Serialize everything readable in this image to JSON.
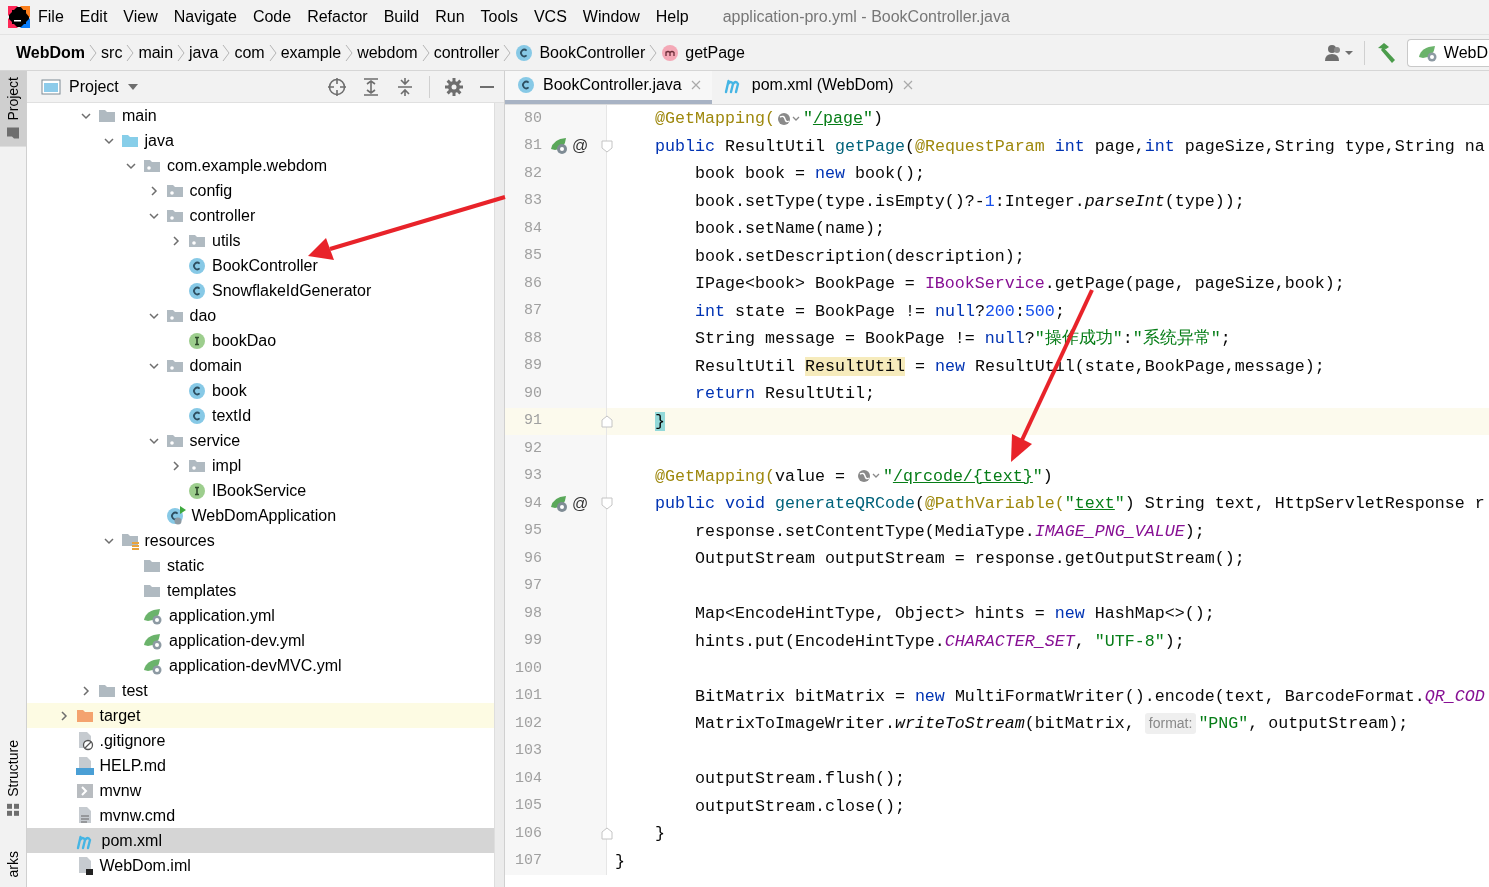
{
  "menu": [
    {
      "label": "File"
    },
    {
      "label": "Edit"
    },
    {
      "label": "View"
    },
    {
      "label": "Navigate"
    },
    {
      "label": "Code"
    },
    {
      "label": "Refactor"
    },
    {
      "label": "Build"
    },
    {
      "label": "Run"
    },
    {
      "label": "Tools"
    },
    {
      "label": "VCS"
    },
    {
      "label": "Window"
    },
    {
      "label": "Help"
    }
  ],
  "title": "application-pro.yml - BookController.java",
  "breadcrumbs": [
    {
      "label": "WebDom",
      "kind": "project"
    },
    {
      "label": "src",
      "kind": "folder"
    },
    {
      "label": "main",
      "kind": "folder"
    },
    {
      "label": "java",
      "kind": "folder"
    },
    {
      "label": "com",
      "kind": "folder"
    },
    {
      "label": "example",
      "kind": "folder"
    },
    {
      "label": "webdom",
      "kind": "folder"
    },
    {
      "label": "controller",
      "kind": "folder"
    },
    {
      "label": "BookController",
      "kind": "class"
    },
    {
      "label": "getPage",
      "kind": "method"
    }
  ],
  "toolbar": {
    "run_config": "WebD"
  },
  "tool_strip": [
    {
      "label": "Project",
      "selected": true
    },
    {
      "label": "Structure",
      "selected": false
    },
    {
      "label": "arks",
      "selected": false
    }
  ],
  "project_panel": {
    "title": "Project",
    "src_children": [
      {
        "label": "main",
        "kind": "folder",
        "expanded": true,
        "selected": false,
        "children": [
          {
            "label": "java",
            "kind": "source",
            "expanded": true,
            "selected": false,
            "children": [
              {
                "label": "com.example.webdom",
                "kind": "package",
                "expanded": true,
                "selected": false,
                "children": [
                  {
                    "label": "config",
                    "kind": "package",
                    "expanded": false,
                    "selected": false
                  },
                  {
                    "label": "controller",
                    "kind": "package",
                    "expanded": true,
                    "selected": false,
                    "children": [
                      {
                        "label": "utils",
                        "kind": "package",
                        "expanded": false,
                        "selected": false
                      },
                      {
                        "label": "BookController",
                        "kind": "class",
                        "selected": false
                      },
                      {
                        "label": "SnowflakeIdGenerator",
                        "kind": "class",
                        "selected": false
                      }
                    ]
                  },
                  {
                    "label": "dao",
                    "kind": "package",
                    "expanded": true,
                    "selected": false,
                    "children": [
                      {
                        "label": "bookDao",
                        "kind": "interface",
                        "selected": false
                      }
                    ]
                  },
                  {
                    "label": "domain",
                    "kind": "package",
                    "expanded": true,
                    "selected": false,
                    "children": [
                      {
                        "label": "book",
                        "kind": "class",
                        "selected": false
                      },
                      {
                        "label": "textId",
                        "kind": "class",
                        "selected": false
                      }
                    ]
                  },
                  {
                    "label": "service",
                    "kind": "package",
                    "expanded": true,
                    "selected": false,
                    "children": [
                      {
                        "label": "impl",
                        "kind": "package",
                        "expanded": false,
                        "selected": false
                      },
                      {
                        "label": "IBookService",
                        "kind": "interface",
                        "selected": false
                      }
                    ]
                  },
                  {
                    "label": "WebDomApplication",
                    "kind": "app",
                    "selected": false
                  }
                ]
              }
            ]
          },
          {
            "label": "resources",
            "kind": "resources",
            "expanded": true,
            "selected": false,
            "children": [
              {
                "label": "static",
                "kind": "folder",
                "selected": false
              },
              {
                "label": "templates",
                "kind": "folder",
                "selected": false
              },
              {
                "label": "application.yml",
                "kind": "yml",
                "selected": false
              },
              {
                "label": "application-dev.yml",
                "kind": "yml",
                "selected": false
              },
              {
                "label": "application-devMVC.yml",
                "kind": "yml",
                "selected": false
              }
            ]
          }
        ]
      },
      {
        "label": "test",
        "kind": "folder",
        "expanded": false,
        "selected": false
      }
    ],
    "module_children": [
      {
        "label": "target",
        "kind": "excluded",
        "expanded": false,
        "selected": false
      },
      {
        "label": ".gitignore",
        "kind": "gitignore",
        "selected": false
      },
      {
        "label": "HELP.md",
        "kind": "markdown",
        "selected": false
      },
      {
        "label": "mvnw",
        "kind": "shell",
        "selected": false
      },
      {
        "label": "mvnw.cmd",
        "kind": "cmd",
        "selected": false
      },
      {
        "label": "pom.xml",
        "kind": "maven",
        "selected": true
      },
      {
        "label": "WebDom.iml",
        "kind": "iml",
        "selected": false
      }
    ]
  },
  "editor": {
    "tabs": [
      {
        "label": "BookController.java",
        "kind": "class",
        "selected": true
      },
      {
        "label": "pom.xml (WebDom)",
        "kind": "maven",
        "selected": false
      }
    ],
    "lines": [
      {
        "number": "80",
        "current": false,
        "tokens": [
          {
            "kind": "ann",
            "text": "    @GetMapping("
          },
          {
            "kind": "inlay"
          },
          {
            "kind": "str",
            "text": "\""
          },
          {
            "kind": "link",
            "text": "/page"
          },
          {
            "kind": "str",
            "text": "\""
          },
          {
            "kind": "plain",
            "text": ")"
          }
        ]
      },
      {
        "number": "81",
        "current": false,
        "marker": "@",
        "fold": {
          "kind": "start",
          "expanded": true
        },
        "tokens": [
          {
            "kind": "kw",
            "text": "    public"
          },
          {
            "kind": "plain",
            "text": " ResultUtil "
          },
          {
            "kind": "method",
            "text": "getPage"
          },
          {
            "kind": "plain",
            "text": "("
          },
          {
            "kind": "ann",
            "text": "@RequestParam"
          },
          {
            "kind": "kw",
            "text": " int"
          },
          {
            "kind": "plain",
            "text": " page,"
          },
          {
            "kind": "kw",
            "text": "int"
          },
          {
            "kind": "plain",
            "text": " pageSize,String type,String na"
          }
        ]
      },
      {
        "number": "82",
        "current": false,
        "tokens": [
          {
            "kind": "plain",
            "text": "        book book = "
          },
          {
            "kind": "kw",
            "text": "new"
          },
          {
            "kind": "plain",
            "text": " book();"
          }
        ]
      },
      {
        "number": "83",
        "current": false,
        "tokens": [
          {
            "kind": "plain",
            "text": "        book.setType(type.isEmpty()?-"
          },
          {
            "kind": "num",
            "text": "1"
          },
          {
            "kind": "plain",
            "text": ":Integer."
          },
          {
            "kind": "ital",
            "text": "parseInt"
          },
          {
            "kind": "plain",
            "text": "(type));"
          }
        ]
      },
      {
        "number": "84",
        "current": false,
        "tokens": [
          {
            "kind": "plain",
            "text": "        book.setName(name);"
          }
        ]
      },
      {
        "number": "85",
        "current": false,
        "tokens": [
          {
            "kind": "plain",
            "text": "        book.setDescription(description);"
          }
        ]
      },
      {
        "number": "86",
        "current": false,
        "tokens": [
          {
            "kind": "plain",
            "text": "        IPage<book> BookPage = "
          },
          {
            "kind": "iface",
            "text": "IBookService"
          },
          {
            "kind": "plain",
            "text": ".getPage(page, pageSize,book);"
          }
        ]
      },
      {
        "number": "87",
        "current": false,
        "tokens": [
          {
            "kind": "kw",
            "text": "        int"
          },
          {
            "kind": "plain",
            "text": " state = BookPage != "
          },
          {
            "kind": "kw",
            "text": "null"
          },
          {
            "kind": "plain",
            "text": "?"
          },
          {
            "kind": "num",
            "text": "200"
          },
          {
            "kind": "plain",
            "text": ":"
          },
          {
            "kind": "num",
            "text": "500"
          },
          {
            "kind": "plain",
            "text": ";"
          }
        ]
      },
      {
        "number": "88",
        "current": false,
        "tokens": [
          {
            "kind": "plain",
            "text": "        String message = BookPage != "
          },
          {
            "kind": "kw",
            "text": "null"
          },
          {
            "kind": "plain",
            "text": "?"
          },
          {
            "kind": "str",
            "text": "\"操作成功\""
          },
          {
            "kind": "plain",
            "text": ":"
          },
          {
            "kind": "str",
            "text": "\"系统异常\""
          },
          {
            "kind": "plain",
            "text": ";"
          }
        ]
      },
      {
        "number": "89",
        "current": false,
        "tokens": [
          {
            "kind": "plain",
            "text": "        ResultUtil "
          },
          {
            "kind": "hl",
            "text": "ResultUtil"
          },
          {
            "kind": "plain",
            "text": " = "
          },
          {
            "kind": "kw",
            "text": "new"
          },
          {
            "kind": "plain",
            "text": " ResultUtil(state,BookPage,message);"
          }
        ]
      },
      {
        "number": "90",
        "current": false,
        "tokens": [
          {
            "kind": "kw",
            "text": "        return"
          },
          {
            "kind": "plain",
            "text": " ResultUtil;"
          }
        ]
      },
      {
        "number": "91",
        "current": true,
        "fold": {
          "kind": "end"
        },
        "tokens": [
          {
            "kind": "brace",
            "text": "    }"
          }
        ]
      },
      {
        "number": "92",
        "current": false
      },
      {
        "number": "93",
        "current": false,
        "tokens": [
          {
            "kind": "ann",
            "text": "    @GetMapping("
          },
          {
            "kind": "plain",
            "text": "value = "
          },
          {
            "kind": "inlay"
          },
          {
            "kind": "str",
            "text": "\""
          },
          {
            "kind": "link",
            "text": "/qrcode/{text}"
          },
          {
            "kind": "str",
            "text": "\""
          },
          {
            "kind": "plain",
            "text": ")"
          }
        ]
      },
      {
        "number": "94",
        "current": false,
        "marker": "@",
        "fold": {
          "kind": "start",
          "expanded": true
        },
        "tokens": [
          {
            "kind": "kw",
            "text": "    public void "
          },
          {
            "kind": "method",
            "text": "generateQRCode"
          },
          {
            "kind": "plain",
            "text": "("
          },
          {
            "kind": "ann",
            "text": "@PathVariable("
          },
          {
            "kind": "str",
            "text": "\""
          },
          {
            "kind": "link",
            "text": "text"
          },
          {
            "kind": "str",
            "text": "\""
          },
          {
            "kind": "plain",
            "text": ") String text, HttpServletResponse r"
          }
        ]
      },
      {
        "number": "95",
        "current": false,
        "tokens": [
          {
            "kind": "plain",
            "text": "        response.setContentType(MediaType."
          },
          {
            "kind": "field",
            "text": "IMAGE_PNG_VALUE"
          },
          {
            "kind": "plain",
            "text": ");"
          }
        ]
      },
      {
        "number": "96",
        "current": false,
        "tokens": [
          {
            "kind": "plain",
            "text": "        OutputStream outputStream = response.getOutputStream();"
          }
        ]
      },
      {
        "number": "97",
        "current": false
      },
      {
        "number": "98",
        "current": false,
        "tokens": [
          {
            "kind": "plain",
            "text": "        Map<EncodeHintType, Object> hints = "
          },
          {
            "kind": "kw",
            "text": "new"
          },
          {
            "kind": "plain",
            "text": " HashMap<>();"
          }
        ]
      },
      {
        "number": "99",
        "current": false,
        "tokens": [
          {
            "kind": "plain",
            "text": "        hints.put(EncodeHintType."
          },
          {
            "kind": "field",
            "text": "CHARACTER_SET"
          },
          {
            "kind": "plain",
            "text": ", "
          },
          {
            "kind": "str",
            "text": "\"UTF-8\""
          },
          {
            "kind": "plain",
            "text": ");"
          }
        ]
      },
      {
        "number": "100",
        "current": false
      },
      {
        "number": "101",
        "current": false,
        "tokens": [
          {
            "kind": "plain",
            "text": "        BitMatrix bitMatrix = "
          },
          {
            "kind": "kw",
            "text": "new"
          },
          {
            "kind": "plain",
            "text": " MultiFormatWriter().encode(text, BarcodeFormat."
          },
          {
            "kind": "field",
            "text": "QR_COD"
          }
        ]
      },
      {
        "number": "102",
        "current": false,
        "tokens": [
          {
            "kind": "plain",
            "text": "        MatrixToImageWriter."
          },
          {
            "kind": "ital",
            "text": "writeToStream"
          },
          {
            "kind": "plain",
            "text": "(bitMatrix, "
          },
          {
            "kind": "hint",
            "text": "format:"
          },
          {
            "kind": "str",
            "text": "\"PNG\""
          },
          {
            "kind": "plain",
            "text": ", outputStream);"
          }
        ]
      },
      {
        "number": "103",
        "current": false
      },
      {
        "number": "104",
        "current": false,
        "tokens": [
          {
            "kind": "plain",
            "text": "        outputStream.flush();"
          }
        ]
      },
      {
        "number": "105",
        "current": false,
        "tokens": [
          {
            "kind": "plain",
            "text": "        outputStream.close();"
          }
        ]
      },
      {
        "number": "106",
        "current": false,
        "fold": {
          "kind": "end"
        },
        "tokens": [
          {
            "kind": "plain",
            "text": "    }"
          }
        ]
      },
      {
        "number": "107",
        "current": false,
        "tokens": [
          {
            "kind": "plain",
            "text": "}"
          }
        ]
      }
    ]
  }
}
